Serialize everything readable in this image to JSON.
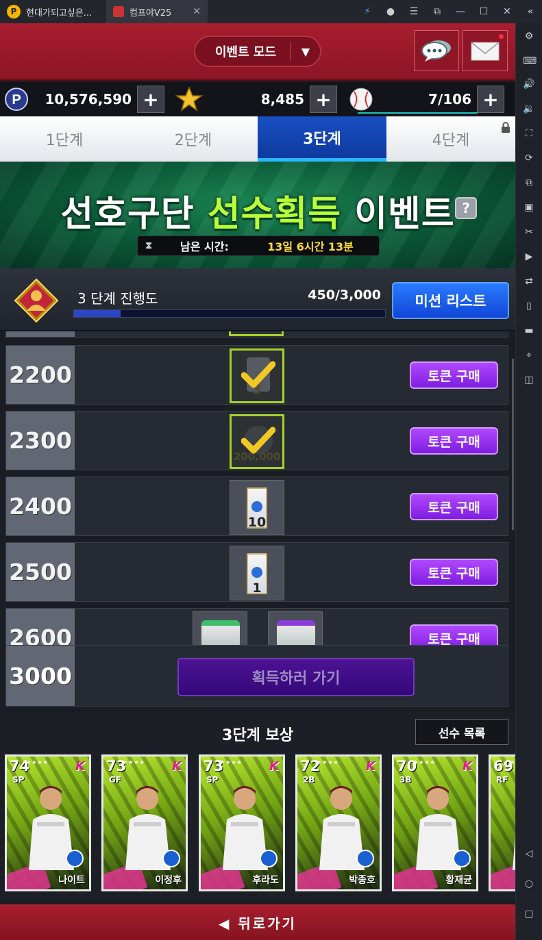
{
  "browser": {
    "tabs": [
      {
        "title": "현대가되고싶은..."
      },
      {
        "title": "컴프야V25"
      }
    ]
  },
  "topbar": {
    "mode_label": "이벤트 모드"
  },
  "resources": {
    "points": "10,576,590",
    "stars": "8,485",
    "balls": "7/106"
  },
  "step_tabs": [
    {
      "label": "1단계"
    },
    {
      "label": "2단계"
    },
    {
      "label": "3단계",
      "active": true
    },
    {
      "label": "4단계",
      "locked": true
    }
  ],
  "banner": {
    "title_part1": "선호구단 ",
    "title_part2": "선수획득",
    "title_part3": " 이벤트",
    "help": "?",
    "timer_label": "남은 시간:",
    "timer_value": "13일 6시간 13분"
  },
  "progress": {
    "label": "3 단계 진행도",
    "value": "450/3,000",
    "fraction": 0.15,
    "mission_button": "미션 리스트"
  },
  "milestones": [
    {
      "points": "2200",
      "item_qty": "3",
      "claimed": true,
      "buy_label": "토큰 구매"
    },
    {
      "points": "2300",
      "item_qty": "200,000",
      "claimed": true,
      "buy_label": "토큰 구매"
    },
    {
      "points": "2400",
      "item_qty": "10",
      "claimed": false,
      "buy_label": "토큰 구매"
    },
    {
      "points": "2500",
      "item_qty": "1",
      "claimed": false,
      "buy_label": "토큰 구매"
    },
    {
      "points": "2600",
      "claimed": false,
      "buy_label": "토큰 구매"
    }
  ],
  "final_milestone": {
    "points": "3000",
    "go_label": "획득하러 가기"
  },
  "rewards": {
    "title": "3단계 보상",
    "roster_button": "선수 목록",
    "cards": [
      {
        "ovr": "74",
        "pos": "SP",
        "name": "나이트"
      },
      {
        "ovr": "73",
        "pos": "GF",
        "name": "이정후"
      },
      {
        "ovr": "73",
        "pos": "SP",
        "name": "후라도"
      },
      {
        "ovr": "72",
        "pos": "2B",
        "name": "박종호"
      },
      {
        "ovr": "70",
        "pos": "3B",
        "name": "황재균"
      },
      {
        "ovr": "69",
        "pos": "RF",
        "name": ""
      }
    ]
  },
  "footer": {
    "back_label": "◀ 뒤로가기"
  },
  "colors": {
    "brand_red": "#a81e2e",
    "active_tab_blue": "#1a4fc2",
    "buy_purple": "#9a34f2",
    "title_green": "#b8ff3a"
  }
}
